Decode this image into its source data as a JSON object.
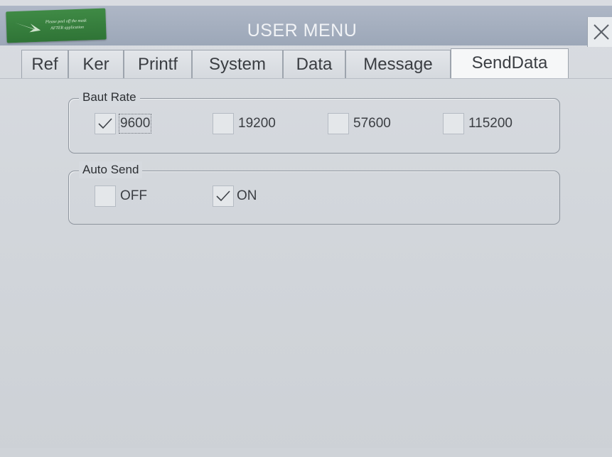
{
  "window": {
    "title": "USER MENU",
    "close_icon": "close-icon"
  },
  "sticker": {
    "line1": "Please peel off the mask",
    "line2": "AFTER application"
  },
  "tabs": [
    {
      "label": "Ref",
      "active": false
    },
    {
      "label": "Ker",
      "active": false
    },
    {
      "label": "Printf",
      "active": false
    },
    {
      "label": "System",
      "active": false
    },
    {
      "label": "Data",
      "active": false
    },
    {
      "label": "Message",
      "active": false
    },
    {
      "label": "SendData",
      "active": true
    }
  ],
  "baud_rate": {
    "title": "Baut Rate",
    "options": [
      {
        "label": "9600",
        "checked": true
      },
      {
        "label": "19200",
        "checked": false
      },
      {
        "label": "57600",
        "checked": false
      },
      {
        "label": "115200",
        "checked": false
      }
    ]
  },
  "auto_send": {
    "title": "Auto Send",
    "options": [
      {
        "label": "OFF",
        "checked": false
      },
      {
        "label": "ON",
        "checked": true
      }
    ]
  },
  "colors": {
    "titlebar": "#a3adbd",
    "background": "#d3d7dc",
    "sticker": "#3a8240"
  }
}
